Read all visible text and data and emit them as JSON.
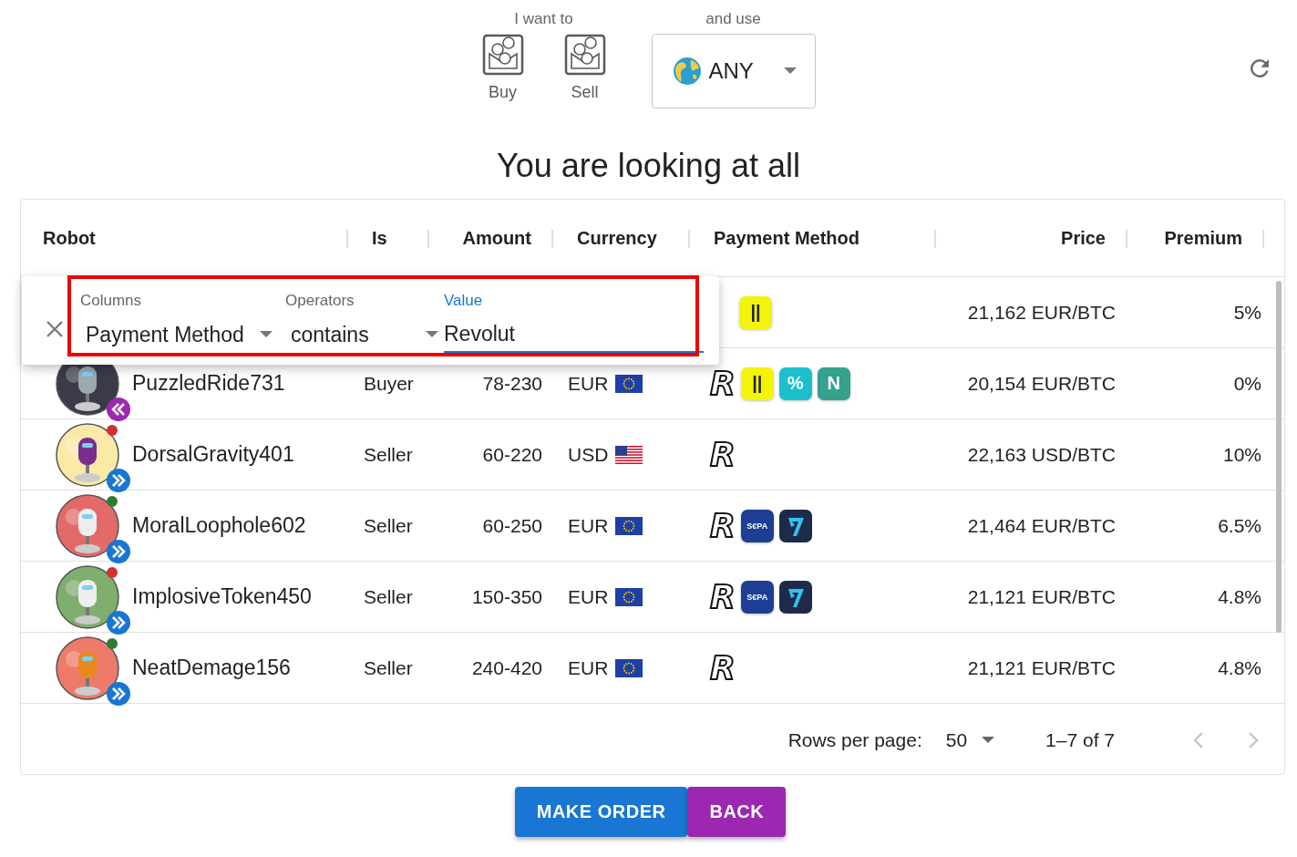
{
  "top": {
    "want_label": "I want to",
    "sides": [
      {
        "label": "Buy",
        "selected": false
      },
      {
        "label": "Sell",
        "selected": false
      }
    ],
    "use_label": "and use",
    "currency_select": {
      "value": "ANY"
    }
  },
  "heading": "You are looking at all",
  "table": {
    "columns": [
      "Robot",
      "Is",
      "Amount",
      "Currency",
      "Payment Method",
      "Price",
      "Premium"
    ],
    "filter": {
      "columns_label": "Columns",
      "column_value": "Payment Method",
      "operators_label": "Operators",
      "operator_value": "contains",
      "value_label": "Value",
      "value": "Revolut"
    },
    "rows": [
      {
        "methods": [
          {
            "kind": "tile",
            "text": "||",
            "color": "#f4f40a"
          }
        ],
        "price": "21,162 EUR/BTC",
        "premium": "5%"
      },
      {
        "robot": "PuzzledRide731",
        "badge": {
          "kind": "buy"
        },
        "is": "Buyer",
        "amount": "78-230",
        "currency": "EUR",
        "flag": {
          "kind": "eu"
        },
        "methods": [
          {
            "kind": "letter",
            "text": "R"
          },
          {
            "kind": "tile",
            "text": "||",
            "color": "#f4f40a"
          },
          {
            "kind": "tile",
            "text": "%",
            "color": "#1cbfcc"
          },
          {
            "kind": "tile",
            "text": "N",
            "color": "#36a18c"
          }
        ],
        "price": "20,154 EUR/BTC",
        "premium": "0%"
      },
      {
        "robot": "DorsalGravity401",
        "badge": {
          "kind": "sell"
        },
        "status_dot": {
          "color": "#d32f2f"
        },
        "is": "Seller",
        "amount": "60-220",
        "currency": "USD",
        "flag": {
          "kind": "us"
        },
        "methods": [
          {
            "kind": "letter",
            "text": "R"
          }
        ],
        "price": "22,163 USD/BTC",
        "premium": "10%"
      },
      {
        "robot": "MoralLoophole602",
        "badge": {
          "kind": "sell"
        },
        "status_dot": {
          "color": "#2e7d32"
        },
        "is": "Seller",
        "amount": "60-250",
        "currency": "EUR",
        "flag": {
          "kind": "eu"
        },
        "methods": [
          {
            "kind": "letter",
            "text": "R"
          },
          {
            "kind": "tile",
            "text": "S€PA",
            "color": "#1d3e94"
          },
          {
            "kind": "arrow-tile",
            "color": "#1e2a4a"
          }
        ],
        "price": "21,464 EUR/BTC",
        "premium": "6.5%"
      },
      {
        "robot": "ImplosiveToken450",
        "badge": {
          "kind": "sell"
        },
        "status_dot": {
          "color": "#d32f2f"
        },
        "is": "Seller",
        "amount": "150-350",
        "currency": "EUR",
        "flag": {
          "kind": "eu"
        },
        "methods": [
          {
            "kind": "letter",
            "text": "R"
          },
          {
            "kind": "tile",
            "text": "S€PA",
            "color": "#1d3e94"
          },
          {
            "kind": "arrow-tile",
            "color": "#1e2a4a"
          }
        ],
        "price": "21,121 EUR/BTC",
        "premium": "4.8%"
      },
      {
        "robot": "NeatDemage156",
        "badge": {
          "kind": "sell"
        },
        "status_dot": {
          "color": "#2e7d32"
        },
        "is": "Seller",
        "amount": "240-420",
        "currency": "EUR",
        "flag": {
          "kind": "eu"
        },
        "methods": [
          {
            "kind": "letter",
            "text": "R"
          }
        ],
        "price": "21,121 EUR/BTC",
        "premium": "4.8%"
      }
    ],
    "footer": {
      "rows_per_page_label": "Rows per page:",
      "rows_per_page": "50",
      "range": "1–7 of 7"
    }
  },
  "buttons": [
    {
      "label": "MAKE ORDER",
      "kind": "primary"
    },
    {
      "label": "BACK",
      "kind": "secondary"
    }
  ]
}
